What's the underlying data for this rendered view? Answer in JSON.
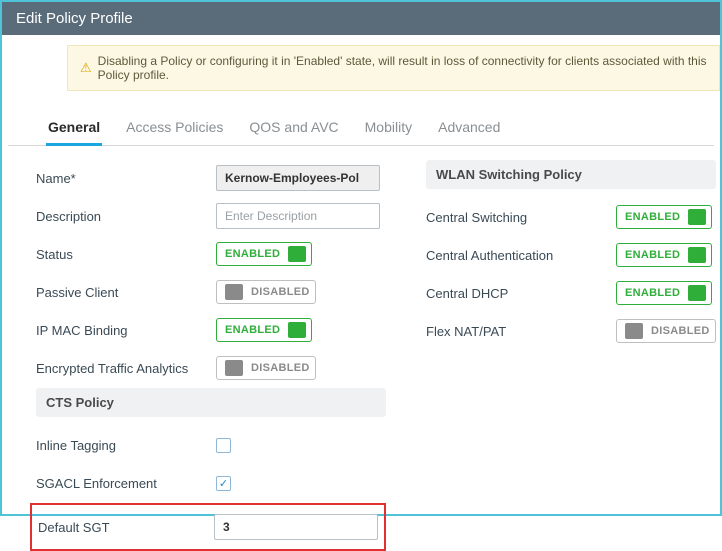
{
  "window": {
    "title": "Edit Policy Profile"
  },
  "warning": {
    "icon": "⚠",
    "text": "Disabling a Policy or configuring it in 'Enabled' state, will result in loss of connectivity for clients associated with this Policy profile."
  },
  "tabs": {
    "general": "General",
    "access": "Access Policies",
    "qos": "QOS and AVC",
    "mobility": "Mobility",
    "advanced": "Advanced"
  },
  "toggle_labels": {
    "enabled": "ENABLED",
    "disabled": "DISABLED"
  },
  "left": {
    "name_label": "Name*",
    "name_value": "Kernow-Employees-Pol",
    "desc_label": "Description",
    "desc_placeholder": "Enter Description",
    "status_label": "Status",
    "passive_label": "Passive Client",
    "ipmac_label": "IP MAC Binding",
    "eta_label": "Encrypted Traffic Analytics",
    "cts_header": "CTS Policy",
    "inline_label": "Inline Tagging",
    "sgacl_label": "SGACL Enforcement",
    "sgt_label": "Default SGT",
    "sgt_value": "3",
    "check": "✓"
  },
  "right": {
    "header": "WLAN Switching Policy",
    "csw_label": "Central Switching",
    "cauth_label": "Central Authentication",
    "cdhcp_label": "Central DHCP",
    "flex_label": "Flex NAT/PAT"
  }
}
